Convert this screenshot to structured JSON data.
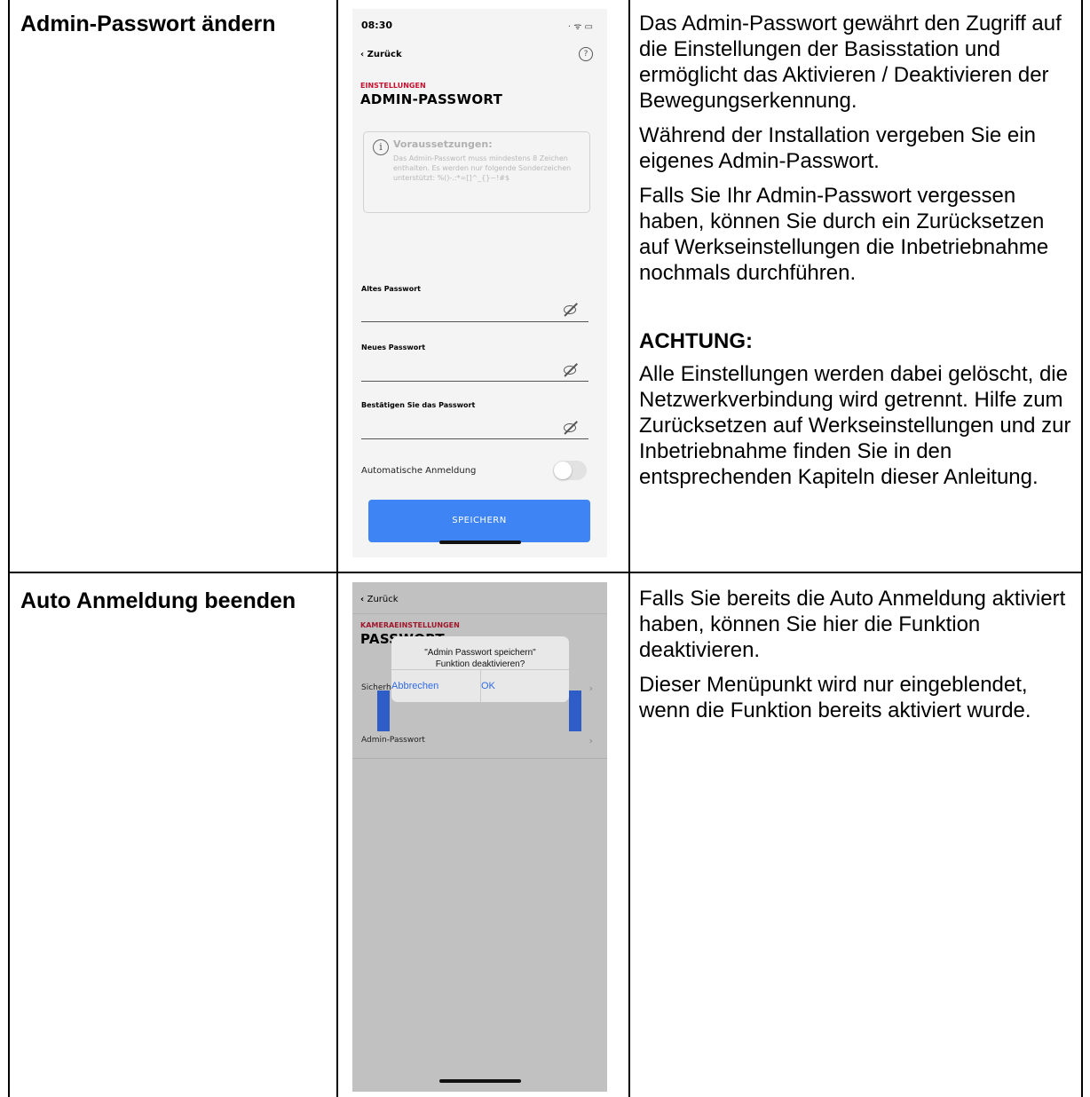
{
  "row1": {
    "title": "Admin-Passwort ändern",
    "description": [
      "Das Admin-Passwort gewährt den Zugriff auf die Einstellungen der Basisstation und ermöglicht das Aktivieren / Deaktivieren der Bewegungserkennung.",
      "Während der Installation vergeben Sie ein eigenes Admin-Passwort.",
      "Falls Sie Ihr Admin-Passwort vergessen haben, können Sie durch ein Zurücksetzen auf Werkseinstellungen die Inbetriebnahme nochmals durchführen."
    ],
    "warning_title": "ACHTUNG:",
    "warning_text": "Alle Einstellungen werden dabei gelöscht, die Netzwerkverbindung wird getrennt. Hilfe zum Zurücksetzen auf Werkseinstellungen und zur Inbetriebnahme finden Sie in den entsprechenden Kapiteln dieser Anleitung.",
    "phone": {
      "time": "08:30",
      "back_label": "Zurück",
      "help_icon": "?",
      "section": "EINSTELLUNGEN",
      "heading": "ADMIN-PASSWORT",
      "req_icon": "i",
      "req_title": "Voraussetzungen:",
      "req_text": "Das Admin-Passwort muss mindestens 8 Zeichen enthalten. Es werden nur folgende Sonderzeichen unterstützt: %()-.:*=[]^_{}~!#$",
      "field_old": "Altes Passwort",
      "field_new": "Neues Passwort",
      "field_confirm": "Bestätigen Sie das Passwort",
      "auto_login": "Automatische Anmeldung",
      "auto_login_on": false,
      "save_button": "SPEICHERN"
    }
  },
  "row2": {
    "title": "Auto Anmeldung beenden",
    "description": [
      "Falls Sie bereits die Auto Anmeldung aktiviert haben, können Sie hier die Funktion deaktivieren.",
      "Dieser Menüpunkt wird nur eingeblendet, wenn die Funktion bereits aktiviert wurde."
    ],
    "phone": {
      "back_label": "Zurück",
      "section": "KAMERAEINSTELLUNGEN",
      "heading": "PASSWORT",
      "menu_security": "Sicherheitscode",
      "menu_admin": "Admin-Passwort",
      "dialog_line1": "\"Admin Passwort speichern\"",
      "dialog_line2": "Funktion deaktivieren?",
      "dialog_cancel": "Abbrechen",
      "dialog_ok": "OK"
    }
  }
}
